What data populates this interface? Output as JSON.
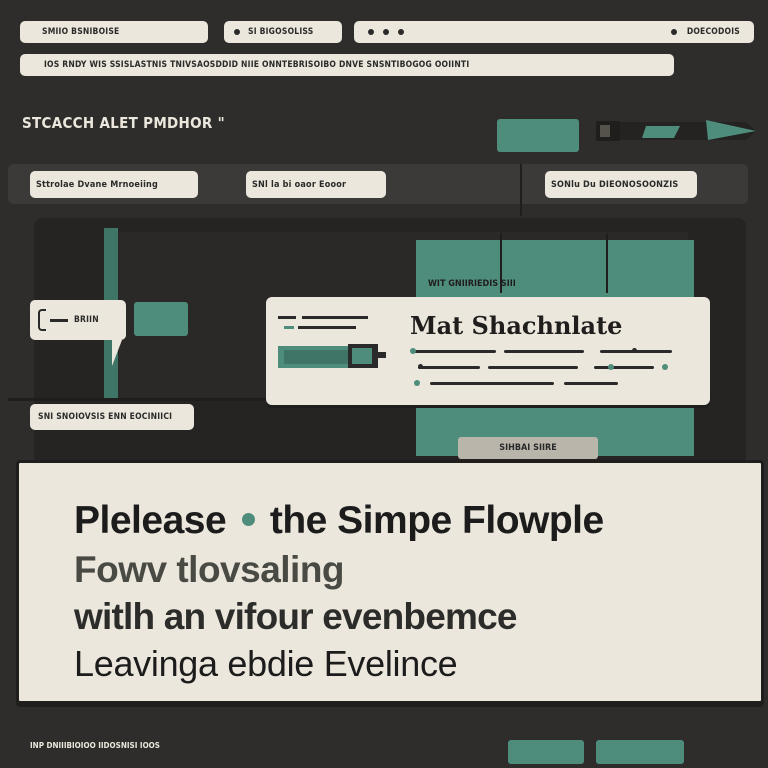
{
  "top_bar": {
    "tab1": "SMIIO BSNIBOISE",
    "tab2": "SI BIGOSOLISS",
    "tab3": "DOECODOIS",
    "url": "IOS RNDY WIS SSISLASTNIS TNIVSAOSDDID NIIE ONNTEBRISOIBO DNVE SNSNTIBOGOG OOIINTI"
  },
  "header": {
    "title": "STCACCH ALET PMDHOR \""
  },
  "toolbar": {
    "field1": "Sttrolae Dvane Mrnoeiing",
    "field2": "SNl la bi oaor Eooor",
    "field3": "SONlu Du DIEONOSOONZIS"
  },
  "panel": {
    "top_label": "WIT GNIIRIEDIS  SIII",
    "side_input": "BRIIN",
    "side_label": "SNI  SNOIOVSIS ENN EOCINIICI",
    "card_title": "Mat Shachnlate",
    "bottom_tab": "SIHBAI SIIRE"
  },
  "main": {
    "line1_a": "Plelease",
    "line1_b": "the Simpe Flowple",
    "line2": "Fowv tlovsaling",
    "line3": "witlh an vifour evenbemce",
    "line4": "Leavinga ebdie Evelince"
  },
  "footer": {
    "text": "INP DNIIIBIOIOO IIDOSNISI IOOS"
  },
  "colors": {
    "accent": "#4e8d7c",
    "background": "#2e2d2c",
    "card": "#ece7dc"
  }
}
